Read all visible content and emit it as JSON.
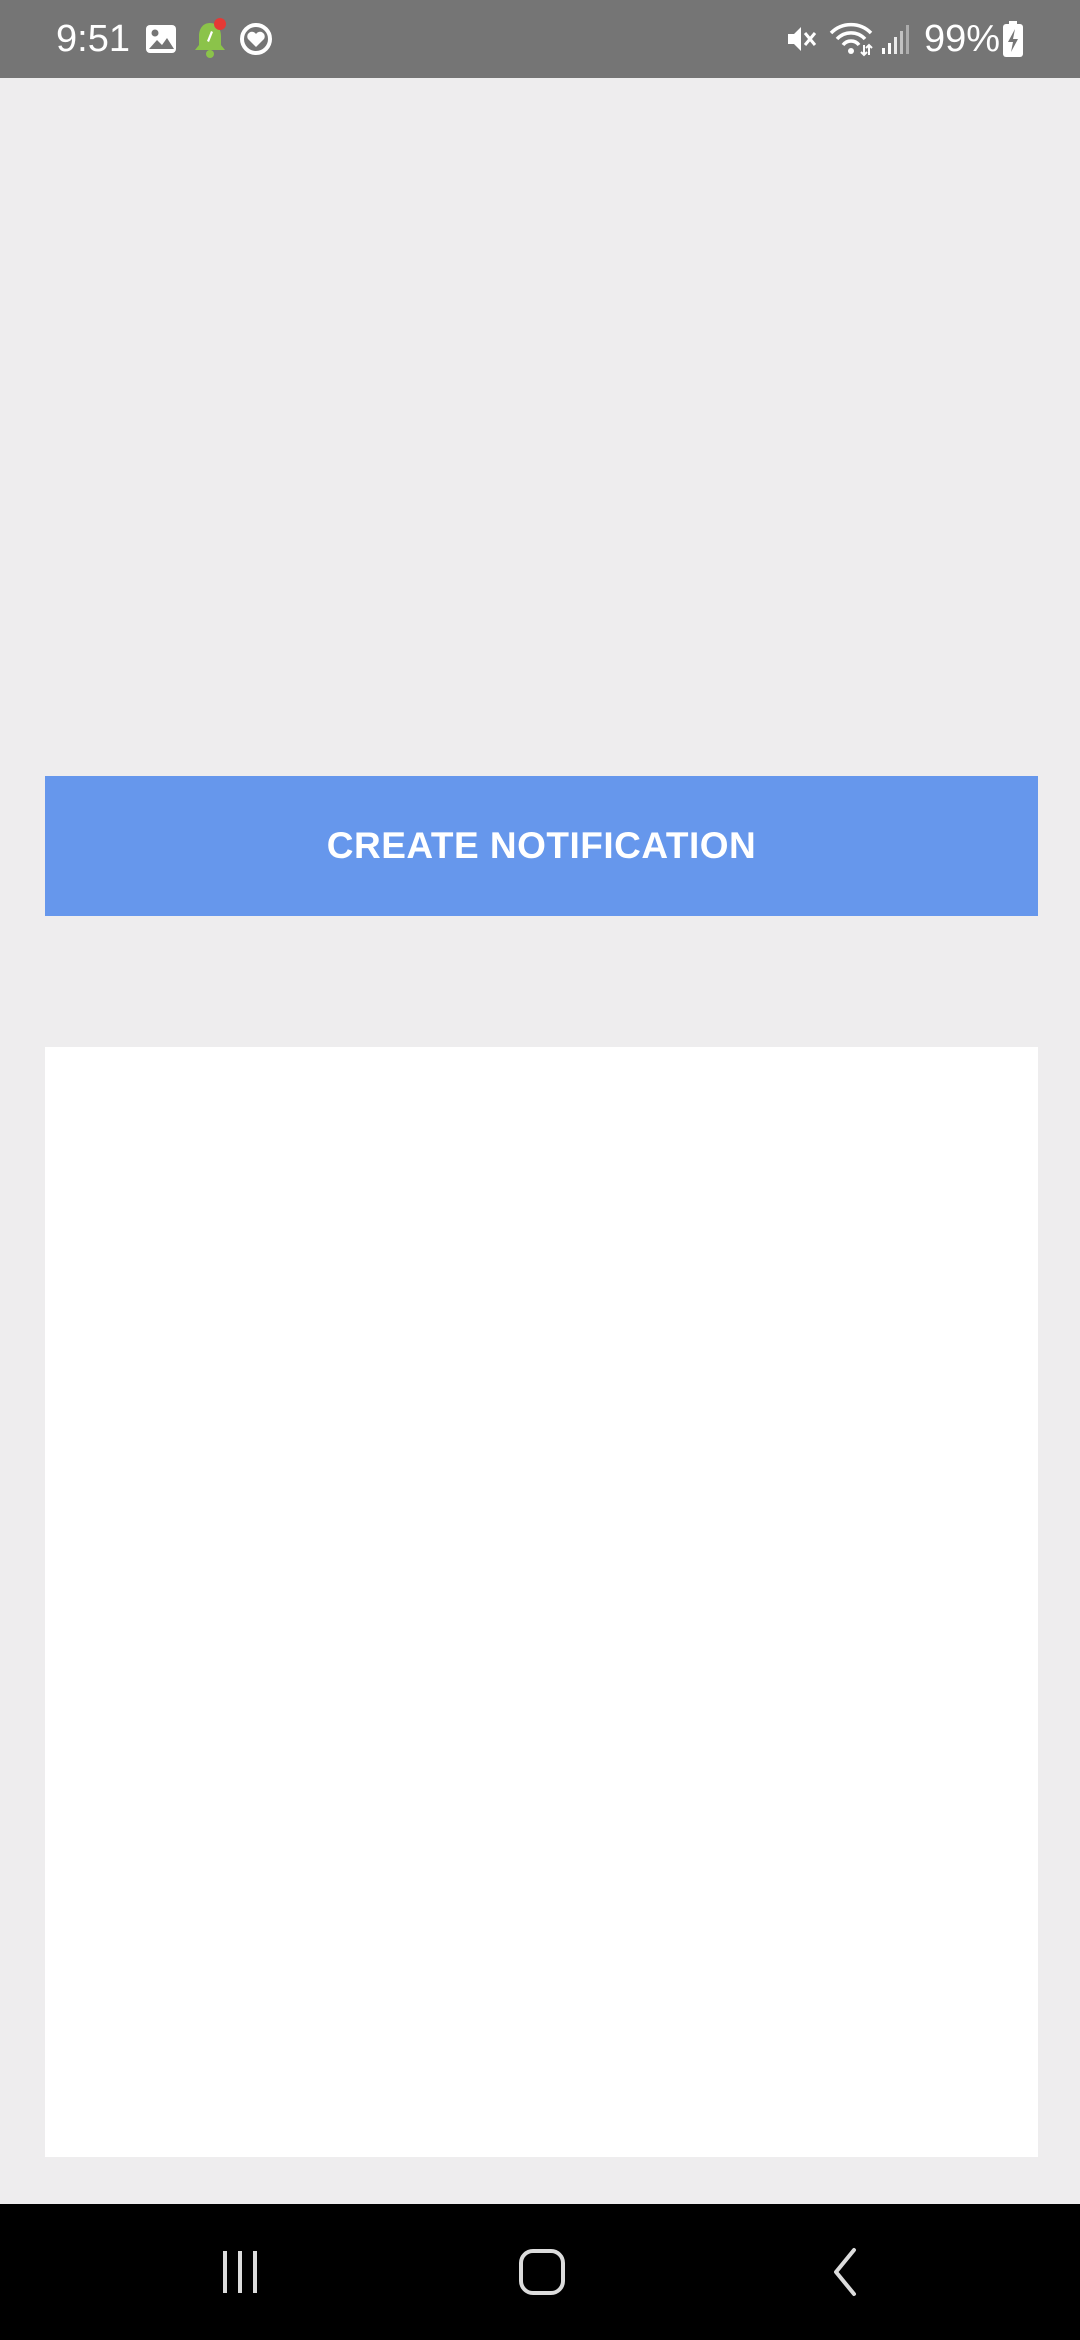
{
  "status_bar": {
    "time": "9:51",
    "battery_percent": "99%",
    "icons_left": [
      "image-icon",
      "notification-bell-icon",
      "heart-sync-icon"
    ],
    "icons_right": [
      "mute-icon",
      "wifi-icon",
      "signal-icon",
      "battery-charging-icon"
    ]
  },
  "main": {
    "create_button_label": "CREATE NOTIFICATION"
  },
  "nav_bar": {
    "buttons": [
      "recent-apps-icon",
      "home-icon",
      "back-icon"
    ]
  },
  "colors": {
    "status_bar": "#757575",
    "background": "#eeedee",
    "button": "#6697ec",
    "panel": "#ffffff",
    "nav_bar": "#000000"
  }
}
